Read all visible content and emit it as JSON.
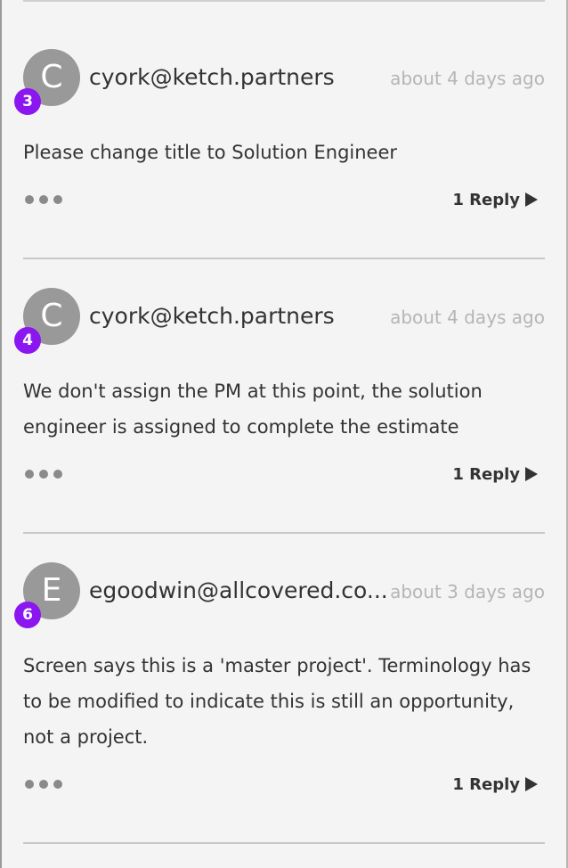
{
  "comments": [
    {
      "avatar_letter": "C",
      "badge": "3",
      "author": "cyork@ketch.partners",
      "timestamp": "about 4 days ago",
      "body": "Please change title to Solution Engineer",
      "reply_label": "1 Reply"
    },
    {
      "avatar_letter": "C",
      "badge": "4",
      "author": "cyork@ketch.partners",
      "timestamp": "about 4 days ago",
      "body": "We don't assign the PM at this point, the solution engineer is assigned to complete the estimate",
      "reply_label": "1 Reply"
    },
    {
      "avatar_letter": "E",
      "badge": "6",
      "author": "egoodwin@allcovered.co...",
      "timestamp": "about 3 days ago",
      "body": "Screen says this is a 'master project'. Terminology has to be modified to indicate this is still an opportunity, not a project.",
      "reply_label": "1 Reply"
    }
  ],
  "colors": {
    "badge": "#8b16f0",
    "avatar": "#999999",
    "timestamp": "#b5b5b5",
    "background": "#f4f4f4"
  },
  "icons": {
    "more": "more-dots-icon",
    "reply": "triangle-right-icon"
  }
}
